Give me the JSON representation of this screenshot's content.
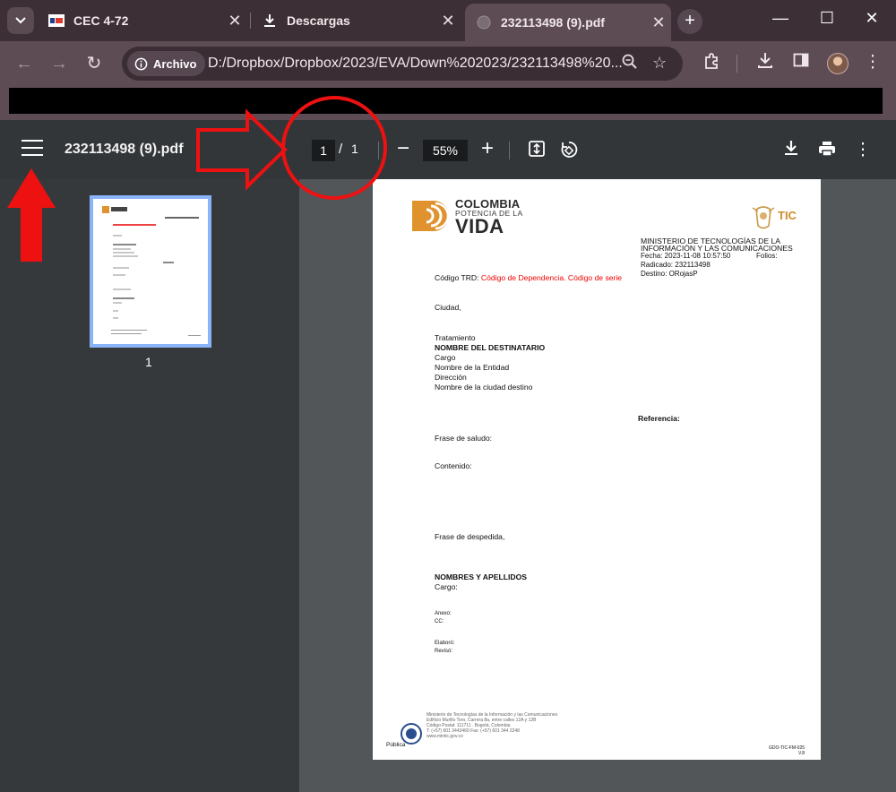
{
  "browser": {
    "tabs": [
      {
        "title": "CEC 4-72",
        "icon": "4-72-favicon"
      },
      {
        "title": "Descargas",
        "icon": "download-icon"
      },
      {
        "title": "232113498 (9).pdf",
        "icon": "globe-icon",
        "active": true
      }
    ],
    "site_chip": "Archivo",
    "url": "D:/Dropbox/Dropbox/2023/EVA/Down%202023/232113498%20..."
  },
  "pdf_toolbar": {
    "title": "232113498 (9).pdf",
    "page_current": "1",
    "page_sep": "/",
    "page_total": "1",
    "zoom": "55%"
  },
  "sidebar": {
    "thumb_label": "1"
  },
  "document": {
    "logo_line1": "COLOMBIA",
    "logo_line2": "POTENCIA DE LA",
    "logo_line3": "VIDA",
    "tic": "TIC",
    "ministry_line1": "MINISTERIO DE TECNOLOGÍAS DE LA",
    "ministry_line2": "INFORMACIÓN Y LAS COMUNICACIONES",
    "fecha": "Fecha: 2023-11-08 10:57:50",
    "folios": "Folios:",
    "radicado": "Radicado: 232113498",
    "destino": "Destino: ORojasP",
    "trd_label": "Código TRD: ",
    "trd_value": "Código de Dependencia. Código de serie",
    "ciudad": "Ciudad,",
    "tratamiento": "Tratamiento",
    "destinatario": "NOMBRE DEL DESTINATARIO",
    "cargo": "Cargo",
    "entidad": "Nombre de la Entidad",
    "direccion": "Dirección",
    "ciudad_destino": "Nombre de la ciudad destino",
    "referencia": "Referencia:",
    "saludo": "Frase de saludo:",
    "contenido": "Contenido:",
    "despedida": "Frase de despedida,",
    "nombres": "NOMBRES Y APELLIDOS",
    "cargo2": "Cargo:",
    "anexo": "Anexo:",
    "cc": "CC:",
    "elaboro": "Elaboró:",
    "reviso": "Revisó:",
    "footer_lines": [
      "Ministerio de Tecnologías de la Información y las Comunicaciones",
      "Edificio Murillo Toro, Carrera 8a, entre calles 12A y 12B",
      "Código Postal: 111711 . Bogotá, Colombia",
      "T: (+57) 601 3443460 Fax: (+57) 601 344 2248",
      "www.mintic.gov.co"
    ],
    "publica": "Pública",
    "code": "GDO-TIC-FM-025",
    "version": "V.8"
  }
}
